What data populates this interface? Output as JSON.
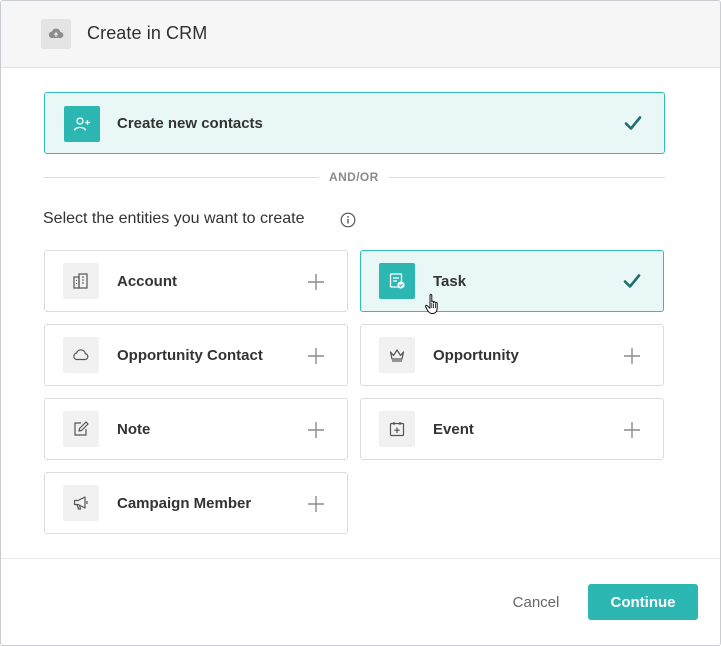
{
  "header": {
    "title": "Create in CRM",
    "icon": "cloud-upload-icon"
  },
  "contacts": {
    "label": "Create new contacts",
    "selected": true,
    "icon": "add-user-icon"
  },
  "separator": {
    "label": "AND/OR"
  },
  "section": {
    "title": "Select the entities you want to create",
    "info_icon": "info-icon"
  },
  "entities": [
    {
      "label": "Account",
      "icon": "building-icon",
      "selected": false
    },
    {
      "label": "Task",
      "icon": "task-icon",
      "selected": true
    },
    {
      "label": "Opportunity Contact",
      "icon": "cloud-icon",
      "selected": false
    },
    {
      "label": "Opportunity",
      "icon": "crown-icon",
      "selected": false
    },
    {
      "label": "Note",
      "icon": "note-edit-icon",
      "selected": false
    },
    {
      "label": "Event",
      "icon": "calendar-plus-icon",
      "selected": false
    },
    {
      "label": "Campaign Member",
      "icon": "megaphone-icon",
      "selected": false
    }
  ],
  "footer": {
    "cancel_label": "Cancel",
    "continue_label": "Continue"
  },
  "colors": {
    "accent": "#2cb7b2",
    "selected_bg": "#e9f8f7",
    "check": "#1f6f6c"
  }
}
